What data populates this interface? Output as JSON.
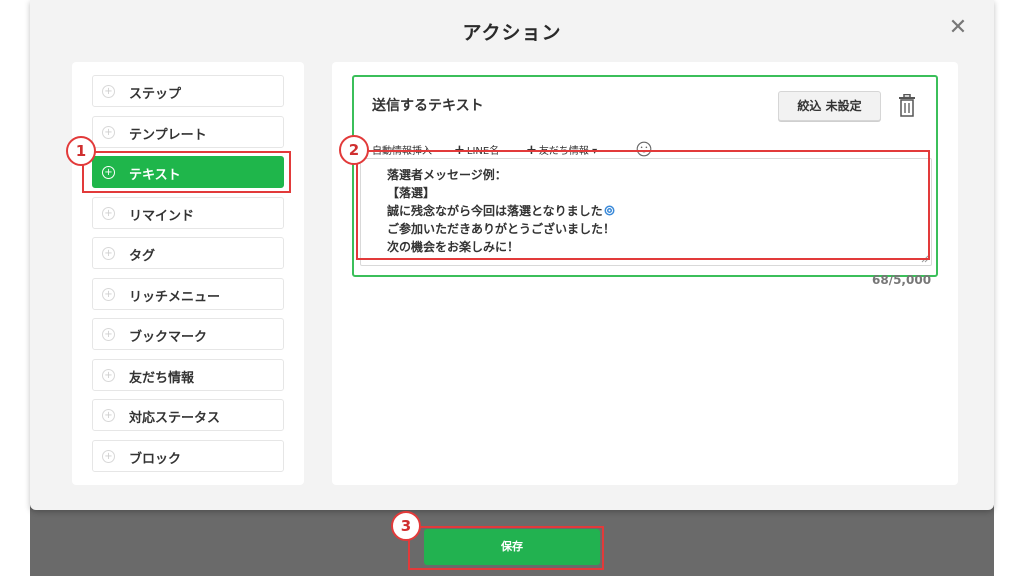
{
  "modal": {
    "title": "アクション",
    "close_icon": "close-icon"
  },
  "menu": {
    "items": [
      {
        "label": "ステップ",
        "active": false
      },
      {
        "label": "テンプレート",
        "active": false
      },
      {
        "label": "テキスト",
        "active": true
      },
      {
        "label": "リマインド",
        "active": false
      },
      {
        "label": "タグ",
        "active": false
      },
      {
        "label": "リッチメニュー",
        "active": false
      },
      {
        "label": "ブックマーク",
        "active": false
      },
      {
        "label": "友だち情報",
        "active": false
      },
      {
        "label": "対応ステータス",
        "active": false
      },
      {
        "label": "ブロック",
        "active": false
      }
    ]
  },
  "editor": {
    "section_label": "送信するテキスト",
    "filter_button": "絞込 未設定",
    "toolbar": {
      "auto_insert": "自動情報挿入",
      "line_name": "LINE名",
      "friend_info": "友だち情報"
    },
    "message_lines": [
      "落選者メッセージ例：",
      "【落選】",
      "誠に残念ながら今回は落選となりました",
      "ご参加いただきありがとうございました！",
      "次の機会をお楽しみに！"
    ],
    "counter": "68/5,000"
  },
  "footer": {
    "save_label": "保存"
  },
  "annotations": {
    "badge_1": "1",
    "badge_2": "2",
    "badge_3": "3"
  },
  "colors": {
    "accent_green": "#1fb64b",
    "highlight_red": "#e23a3a"
  }
}
